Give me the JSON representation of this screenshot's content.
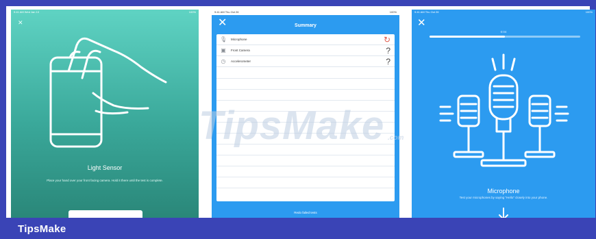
{
  "brand": {
    "label": "TipsMake"
  },
  "watermark": {
    "text": "TipsMake",
    "suffix": ".com"
  },
  "screen1": {
    "status_time": "9:41 AM  Wed Jan 10",
    "status_battery": "100%",
    "close_icon": "close-icon",
    "title": "Light Sensor",
    "description": "Place your hand over your front facing camera. Hold it there until the test is complete."
  },
  "screen2": {
    "status_time": "9:41 AM  Thu Oct 26",
    "status_battery": "100%",
    "nav_title": "Summary",
    "rows": [
      {
        "icon": "microphone-icon",
        "label": "Microphone",
        "status": "retry"
      },
      {
        "icon": "camera-icon",
        "label": "Front Camera",
        "status": "unknown"
      },
      {
        "icon": "accelerometer-icon",
        "label": "Accelerometer",
        "status": "unknown"
      }
    ],
    "redo_label": "Redo failed tests"
  },
  "screen3": {
    "status_time": "9:41 AM  Thu Oct 26",
    "status_battery": "100%",
    "timer": "0:04",
    "progress": 0.5,
    "title": "Microphone",
    "description": "Test your microphones by saying \"Hello\" closely into your phone."
  },
  "colors": {
    "frame": "#3a44b6",
    "teal": "#4bbfae",
    "blue": "#2c9bf0",
    "retry": "#e0584a"
  }
}
